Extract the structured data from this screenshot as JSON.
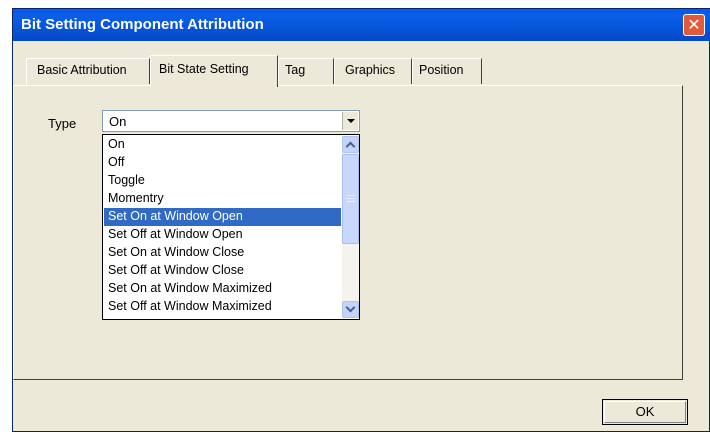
{
  "window": {
    "title": "Bit Setting Component Attribution",
    "close_glyph": "✕"
  },
  "tabs": [
    {
      "label": "Basic Attribution",
      "active": false
    },
    {
      "label": "Bit State Setting",
      "active": true
    },
    {
      "label": "Tag",
      "active": false
    },
    {
      "label": "Graphics",
      "active": false
    },
    {
      "label": "Position",
      "active": false
    }
  ],
  "form": {
    "type_label": "Type",
    "type_value": "On"
  },
  "dropdown": {
    "options": [
      "On",
      "Off",
      "Toggle",
      "Momentry",
      "Set On at Window Open",
      "Set Off at Window Open",
      "Set On at Window Close",
      "Set Off at Window Close",
      "Set On at Window Maximized",
      "Set Off at Window Maximized"
    ],
    "highlighted": "Set On at Window Open"
  },
  "buttons": {
    "ok_label": "OK"
  },
  "colors": {
    "titlebar": "#0a5fe8",
    "selection": "#316ac5",
    "dialog_bg": "#ece9d8"
  }
}
